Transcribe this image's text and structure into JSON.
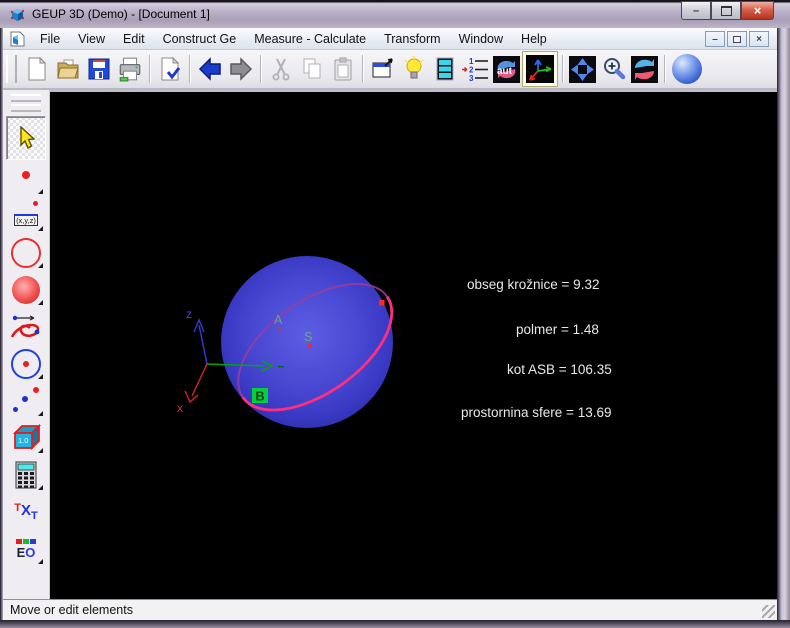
{
  "window": {
    "title": "GEUP 3D (Demo) - [Document 1]",
    "icons": {
      "minimize": "–",
      "maximize": "maximize-box",
      "close": "×",
      "mdi_minimize": "–",
      "mdi_restore": "restore-boxes",
      "mdi_close": "×"
    }
  },
  "menu": {
    "items": [
      "File",
      "View",
      "Edit",
      "Construct Ge",
      "Measure - Calculate",
      "Transform",
      "Window",
      "Help"
    ]
  },
  "toolbar": {
    "auto_label": "aut",
    "steps": {
      "n1": "1",
      "n2": "2",
      "n3": "3"
    }
  },
  "sidebar": {
    "xyz_label": "(x,y,z)",
    "cube_value": "1.0",
    "txt_letters": {
      "t1": "T",
      "x": "X",
      "t2": "T"
    },
    "eo_letters": {
      "e": "E",
      "o": "O"
    }
  },
  "canvas": {
    "axis_labels": {
      "z": "z",
      "x": "x"
    },
    "point_labels": {
      "a": "A",
      "s": "S",
      "b": "B"
    },
    "measurements": [
      "obseg krožnice = 9.32",
      "polmer = 1.48",
      "kot ASB = 106.35",
      "prostornina sfere = 13.69"
    ]
  },
  "statusbar": {
    "text": "Move or edit elements"
  },
  "colors": {
    "sphere": "#4646cf",
    "circle_front": "#ff2f80",
    "circle_back": "#9b3d9b",
    "close_button": "#d8604b",
    "canvas_bg": "#000000"
  }
}
